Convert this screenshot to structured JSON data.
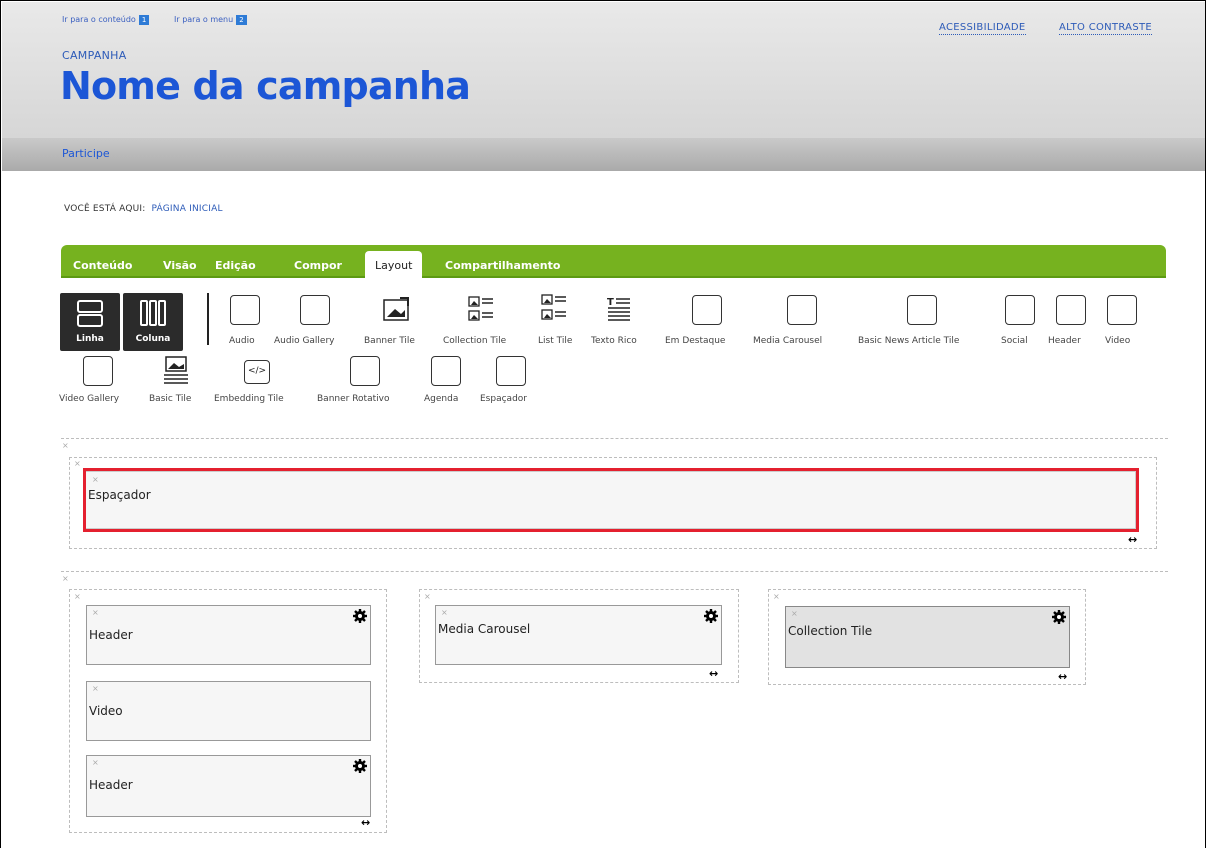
{
  "skip_links": {
    "content": "Ir para o conteúdo",
    "content_num": "1",
    "menu": "Ir para o menu",
    "menu_num": "2"
  },
  "accessibility": {
    "acc": "ACESSIBILIDADE",
    "contrast": "ALTO CONTRASTE"
  },
  "campaign": {
    "label": "CAMPANHA",
    "title": "Nome da campanha"
  },
  "nav": {
    "item": "Participe"
  },
  "breadcrumb": {
    "prefix": "VOCÊ ESTÁ AQUI:",
    "home": "PÁGINA INICIAL"
  },
  "tabs": [
    "Conteúdo",
    "Visão",
    "Edição",
    "Compor",
    "Layout",
    "Compartilhamento"
  ],
  "active_tab": "Layout",
  "layout_buttons": {
    "row": "Linha",
    "column": "Coluna"
  },
  "tile_types_row1": [
    "Audio",
    "Audio Gallery",
    "Banner Tile",
    "Collection Tile",
    "List Tile",
    "Texto Rico",
    "Em Destaque",
    "Media Carousel",
    "Basic News Article Tile",
    "Social",
    "Header",
    "Video"
  ],
  "tile_types_row2": [
    "Video Gallery",
    "Basic Tile",
    "Embedding Tile",
    "Banner Rotativo",
    "Agenda",
    "Espaçador"
  ],
  "icons": {
    "embed": "</>"
  },
  "layout": {
    "row1": {
      "tile": "Espaçador"
    },
    "row2": {
      "col1": [
        "Header",
        "Video",
        "Header"
      ],
      "col2": [
        "Media Carousel"
      ],
      "col3": [
        "Collection Tile"
      ]
    }
  },
  "glyphs": {
    "close": "×",
    "resize": "↔"
  },
  "colors": {
    "accent_green": "#76b21f",
    "title_blue": "#1c56d6",
    "selection_red": "#e4202f"
  }
}
